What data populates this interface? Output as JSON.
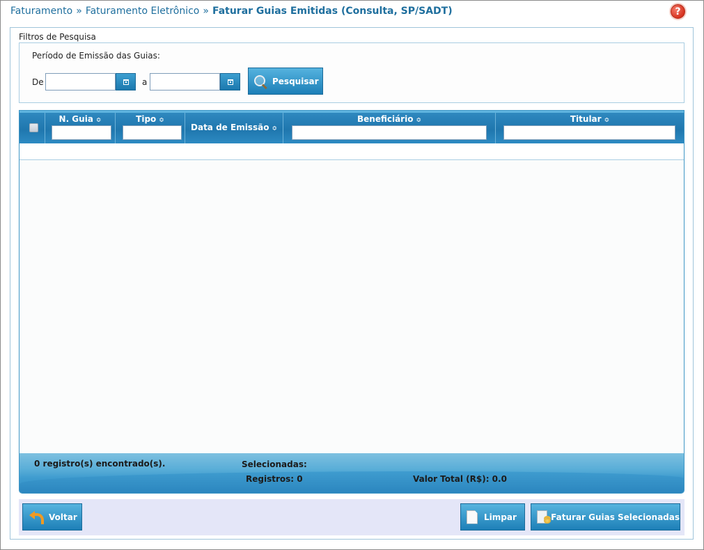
{
  "breadcrumb": {
    "items": [
      "Faturamento",
      "Faturamento Eletrônico"
    ],
    "current": "Faturar Guias Emitidas (Consulta, SP/SADT)",
    "separator": "»"
  },
  "help": {
    "icon": "help-question-icon",
    "label": "?"
  },
  "filters": {
    "legend": "Filtros de Pesquisa",
    "period_label": "Período de Emissão das Guias:",
    "from_label": "De",
    "to_label": "a",
    "from_value": "",
    "to_value": "",
    "search_button": "Pesquisar"
  },
  "grid": {
    "columns": [
      {
        "label": "N. Guia",
        "sortable": true,
        "filter": ""
      },
      {
        "label": "Tipo",
        "sortable": true,
        "filter": ""
      },
      {
        "label": "Data de Emissão",
        "sortable": true
      },
      {
        "label": "Beneficiário",
        "sortable": true,
        "filter": ""
      },
      {
        "label": "Titular",
        "sortable": true,
        "filter": ""
      }
    ],
    "sort_glyph": "≎",
    "rows": [],
    "footer": {
      "records_found": "0 registro(s) encontrado(s).",
      "selected_label": "Selecionadas:",
      "registros": "Registros: 0",
      "valor_total": "Valor Total (R$): 0.0"
    }
  },
  "actions": {
    "back": "Voltar",
    "clear": "Limpar",
    "bill_selected": "Faturar Guias Selecionadas"
  },
  "colors": {
    "accent": "#1f77ae",
    "breadcrumb": "#1f6f9e",
    "action_bar": "#e4e6f8",
    "help": "#d6321e"
  }
}
